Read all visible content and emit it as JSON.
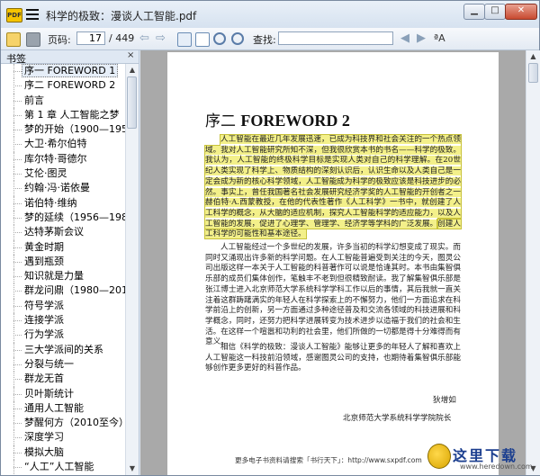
{
  "window": {
    "title": "科学的极致：漫谈人工智能.pdf",
    "app_icon_text": "PDF"
  },
  "toolbar": {
    "page_label": "页码:",
    "current_page": "17",
    "page_total": "/ 449",
    "find_label": "查找:",
    "find_value": ""
  },
  "sidebar": {
    "title": "书签",
    "close_glyph": "×",
    "items": [
      {
        "label": "序一 FOREWORD 1",
        "selected": true
      },
      {
        "label": "序二 FOREWORD 2"
      },
      {
        "label": "前言"
      },
      {
        "label": "第 1 章 人工智能之梦"
      },
      {
        "label": "梦的开始（1900—1956）"
      },
      {
        "label": "大卫·希尔伯特"
      },
      {
        "label": "库尔特·哥德尔"
      },
      {
        "label": "艾伦·图灵"
      },
      {
        "label": "约翰·冯·诺依曼"
      },
      {
        "label": "诺伯特·维纳"
      },
      {
        "label": "梦的延续（1956—1980）"
      },
      {
        "label": "达特茅斯会议"
      },
      {
        "label": "黄金时期"
      },
      {
        "label": "遇到瓶颈"
      },
      {
        "label": "知识就是力量"
      },
      {
        "label": "群龙问鼎（1980—2010）"
      },
      {
        "label": "符号学派"
      },
      {
        "label": "连接学派"
      },
      {
        "label": "行为学派"
      },
      {
        "label": "三大学派间的关系"
      },
      {
        "label": "分裂与统一"
      },
      {
        "label": "群龙无首"
      },
      {
        "label": "贝叶斯统计"
      },
      {
        "label": "通用人工智能"
      },
      {
        "label": "梦醒何方（2010至今）"
      },
      {
        "label": "深度学习"
      },
      {
        "label": "模拟大脑"
      },
      {
        "label": "“人工”人工智能"
      }
    ]
  },
  "document": {
    "heading_prefix": "序二",
    "heading_main": "FOREWORD 2",
    "highlighted_paragraph": "人工智能在最近几年发展迅速，已成为科技界和社会关注的一个热点领域。我对人工智能研究所知不深，但我很欣赏本书的书名——科学的极致。我认为，人工智能的终极科学目标是实现人类对自己的科学理解。在20世纪人类实现了科学上、物质结构的深刻认识后，认识生命以及人类自己是一定会成为新的核心科学领域，人工智能成为科学的极致应该是科技进步的必然。事实上，曾任我国著名社会发展研究经济学奖的人工智能的开创者之一赫伯特·A.西蒙教授，在他的代表性著作《人工科学》一书中，就创建了人工科学的概念，从大脑的适应机制，探究人工智能科学的适应能力，以及人工智能的发展，促进了心理学、管理学、经济学等学科的广泛发展。",
    "highlighted_tail": "创建人工科学的可能性和基本途径。",
    "paragraph_2": "人工智能经过一个多世纪的发展，许多当初的科学幻想变成了现实。而同时又涌现出许多新的科学问题。在人工智能普遍受到关注的今天，图灵公司出版这样一本关于人工智能的科普著作可以说是恰逢其时。本书由集智俱乐部的成员们集体创作，笔触丰不老到但很精致耐读。我了解集智俱乐部是张江博士进入北京师范大学系统科学学科工作以后的事情，其后我就一直关注着这群踌躇满实的年轻人在科学探索上的不懈努力，他们一方面追求在科学前沿上的创新，另一方面通过多种途径普及和交流各领域的科技进展和科学概念，同时，还努力把科学进展转变为技术进步以造福于我们的社会和生活。在这样一个喧嚣和功利的社会里，他们所做的一切都是得十分难得而有意义。",
    "paragraph_3": "相信《科学的极致：漫谈人工智能》能够让更多的年轻人了解和喜欢上人工智能这一科技前沿领域，感谢图灵公司的支持，也期待着集智俱乐部能够创作更多更好的科普作品。",
    "signature_name": "狄增如",
    "signature_affiliation": "北京师范大学系统科学学院院长",
    "footer": "更多电子书资料请搜索「书行天下」：http://www.sxpdf.com"
  },
  "watermark": {
    "text": "这里下载",
    "url": "www.heredown.com"
  }
}
